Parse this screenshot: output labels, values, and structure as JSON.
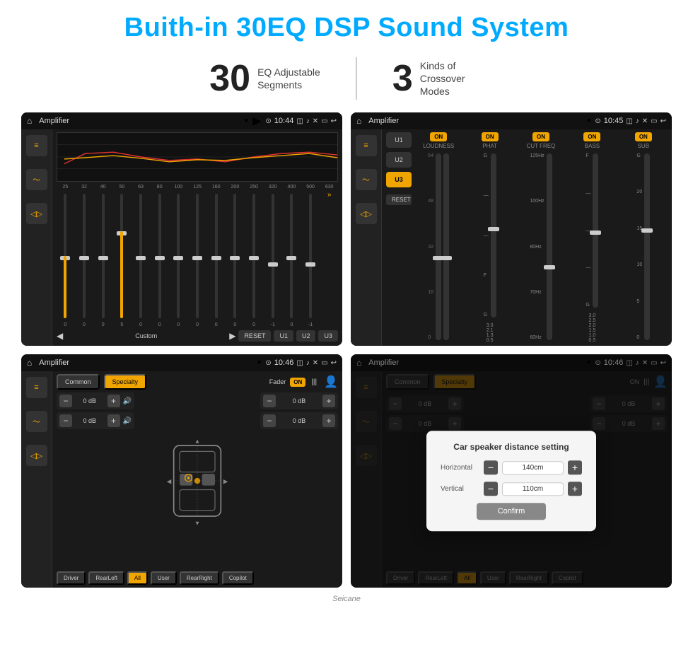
{
  "header": {
    "title": "Buith-in 30EQ DSP Sound System"
  },
  "stats": [
    {
      "number": "30",
      "label": "EQ Adjustable\nSegments"
    },
    {
      "number": "3",
      "label": "Kinds of\nCrossover Modes"
    }
  ],
  "screens": [
    {
      "id": "screen1",
      "statusbar": {
        "title": "Amplifier",
        "time": "10:44"
      },
      "eq_freqs": [
        "25",
        "32",
        "40",
        "50",
        "63",
        "80",
        "100",
        "125",
        "160",
        "200",
        "250",
        "320",
        "400",
        "500",
        "630"
      ],
      "eq_values": [
        "0",
        "0",
        "0",
        "5",
        "0",
        "0",
        "0",
        "0",
        "0",
        "0",
        "0",
        "-1",
        "0",
        "-1"
      ],
      "presets": [
        "Custom"
      ],
      "bottom_btns": [
        "RESET",
        "U1",
        "U2",
        "U3"
      ]
    },
    {
      "id": "screen2",
      "statusbar": {
        "title": "Amplifier",
        "time": "10:45"
      },
      "presets": [
        "U1",
        "U2",
        "U3"
      ],
      "channels": [
        "LOUDNESS",
        "PHAT",
        "CUT FREQ",
        "BASS",
        "SUB"
      ],
      "reset_label": "RESET"
    },
    {
      "id": "screen3",
      "statusbar": {
        "title": "Amplifier",
        "time": "10:46"
      },
      "tabs": [
        "Common",
        "Specialty"
      ],
      "fader_label": "Fader",
      "fader_toggle": "ON",
      "vol_rows": [
        {
          "label": "0 dB"
        },
        {
          "label": "0 dB"
        },
        {
          "label": "0 dB"
        },
        {
          "label": "0 dB"
        }
      ],
      "speaker_btns": [
        "Driver",
        "RearLeft",
        "All",
        "User",
        "RearRight",
        "Copilot"
      ]
    },
    {
      "id": "screen4",
      "statusbar": {
        "title": "Amplifier",
        "time": "10:46"
      },
      "tabs": [
        "Common",
        "Specialty"
      ],
      "dialog": {
        "title": "Car speaker distance setting",
        "rows": [
          {
            "label": "Horizontal",
            "value": "140cm"
          },
          {
            "label": "Vertical",
            "value": "110cm"
          }
        ],
        "confirm_label": "Confirm"
      },
      "speaker_btns": [
        "Driver",
        "RearLeft",
        "All",
        "User",
        "RearRight",
        "Copilot"
      ]
    }
  ],
  "watermark": "Seicane"
}
